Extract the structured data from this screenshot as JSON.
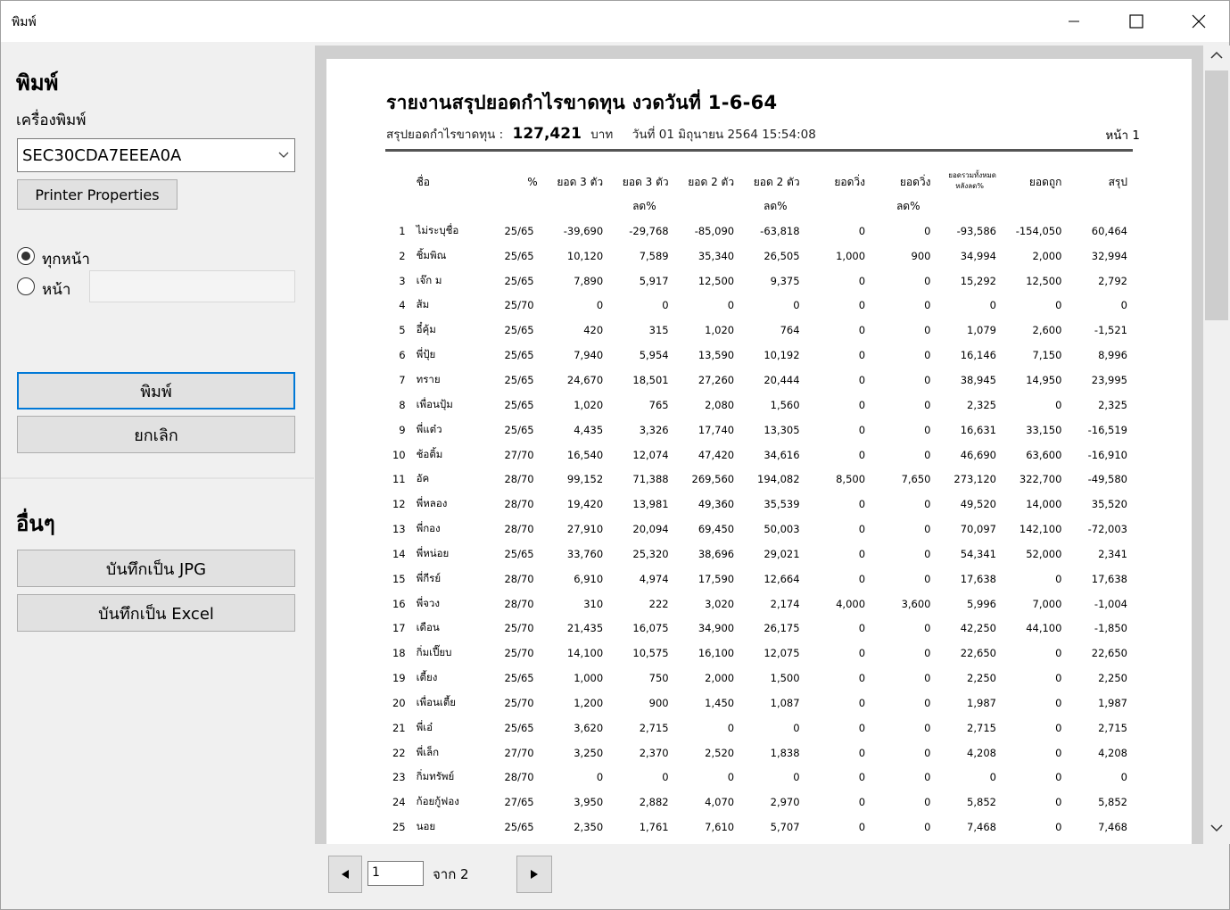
{
  "window": {
    "title": "พิมพ์"
  },
  "left": {
    "print_heading": "พิมพ์",
    "printer_label": "เครื่องพิมพ์",
    "printer_value": "SEC30CDA7EEEA0A",
    "printer_properties": "Printer Properties",
    "radio_all": "ทุกหน้า",
    "radio_page": "หน้า",
    "print_button": "พิมพ์",
    "cancel_button": "ยกเลิก",
    "other_heading": "อื่นๆ",
    "save_jpg": "บันทึกเป็น JPG",
    "save_excel": "บันทึกเป็น Excel"
  },
  "report": {
    "title": "รายงานสรุปยอดกำไรขาดทุน งวดวันที่ 1-6-64",
    "sub_label": "สรุปยอดกำไรขาดทุน :",
    "sub_amount": "127,421",
    "sub_unit": "บาท",
    "sub_date_label": "วันที่",
    "sub_date": "01 มิถุนายน 2564 15:54:08",
    "page_label": "หน้า",
    "page_num": "1",
    "headers": {
      "name": "ชื่อ",
      "pct": "%",
      "c3": "ยอด 3 ตัว",
      "c3d1": "ยอด 3 ตัว",
      "c3d2": "ลด%",
      "c2": "ยอด 2 ตัว",
      "c2d1": "ยอด 2 ตัว",
      "c2d2": "ลด%",
      "run": "ยอดวิ่ง",
      "rund1": "ยอดวิ่ง",
      "rund2": "ลด%",
      "tot1": "ยอดรวมทั้งหมด",
      "tot2": "หลังลด%",
      "hit": "ยอดถูก",
      "sum": "สรุป"
    },
    "rows": [
      [
        "1",
        "ไม่ระบุชื่อ",
        "25/65",
        "-39,690",
        "-29,768",
        "-85,090",
        "-63,818",
        "0",
        "0",
        "-93,586",
        "-154,050",
        "60,464"
      ],
      [
        "2",
        "ชิ้มพิณ",
        "25/65",
        "10,120",
        "7,589",
        "35,340",
        "26,505",
        "1,000",
        "900",
        "34,994",
        "2,000",
        "32,994"
      ],
      [
        "3",
        "เจ๊ก ม",
        "25/65",
        "7,890",
        "5,917",
        "12,500",
        "9,375",
        "0",
        "0",
        "15,292",
        "12,500",
        "2,792"
      ],
      [
        "4",
        "ส้ม",
        "25/70",
        "0",
        "0",
        "0",
        "0",
        "0",
        "0",
        "0",
        "0",
        "0"
      ],
      [
        "5",
        "อี๋คุ้ม",
        "25/65",
        "420",
        "315",
        "1,020",
        "764",
        "0",
        "0",
        "1,079",
        "2,600",
        "-1,521"
      ],
      [
        "6",
        "พี่ปุ้ย",
        "25/65",
        "7,940",
        "5,954",
        "13,590",
        "10,192",
        "0",
        "0",
        "16,146",
        "7,150",
        "8,996"
      ],
      [
        "7",
        "ทราย",
        "25/65",
        "24,670",
        "18,501",
        "27,260",
        "20,444",
        "0",
        "0",
        "38,945",
        "14,950",
        "23,995"
      ],
      [
        "8",
        "เพื่อนปุ้ม",
        "25/65",
        "1,020",
        "765",
        "2,080",
        "1,560",
        "0",
        "0",
        "2,325",
        "0",
        "2,325"
      ],
      [
        "9",
        "พี่แต๋ว",
        "25/65",
        "4,435",
        "3,326",
        "17,740",
        "13,305",
        "0",
        "0",
        "16,631",
        "33,150",
        "-16,519"
      ],
      [
        "10",
        "ช้อติ้ม",
        "27/70",
        "16,540",
        "12,074",
        "47,420",
        "34,616",
        "0",
        "0",
        "46,690",
        "63,600",
        "-16,910"
      ],
      [
        "11",
        "อัค",
        "28/70",
        "99,152",
        "71,388",
        "269,560",
        "194,082",
        "8,500",
        "7,650",
        "273,120",
        "322,700",
        "-49,580"
      ],
      [
        "12",
        "พี่หลอง",
        "28/70",
        "19,420",
        "13,981",
        "49,360",
        "35,539",
        "0",
        "0",
        "49,520",
        "14,000",
        "35,520"
      ],
      [
        "13",
        "พี่กอง",
        "28/70",
        "27,910",
        "20,094",
        "69,450",
        "50,003",
        "0",
        "0",
        "70,097",
        "142,100",
        "-72,003"
      ],
      [
        "14",
        "พี่หน่อย",
        "25/65",
        "33,760",
        "25,320",
        "38,696",
        "29,021",
        "0",
        "0",
        "54,341",
        "52,000",
        "2,341"
      ],
      [
        "15",
        "พี่กีรย์",
        "28/70",
        "6,910",
        "4,974",
        "17,590",
        "12,664",
        "0",
        "0",
        "17,638",
        "0",
        "17,638"
      ],
      [
        "16",
        "พี่จวง",
        "28/70",
        "310",
        "222",
        "3,020",
        "2,174",
        "4,000",
        "3,600",
        "5,996",
        "7,000",
        "-1,004"
      ],
      [
        "17",
        "เดือน",
        "25/70",
        "21,435",
        "16,075",
        "34,900",
        "26,175",
        "0",
        "0",
        "42,250",
        "44,100",
        "-1,850"
      ],
      [
        "18",
        "กิ่มเปี๊ยบ",
        "25/70",
        "14,100",
        "10,575",
        "16,100",
        "12,075",
        "0",
        "0",
        "22,650",
        "0",
        "22,650"
      ],
      [
        "19",
        "เตี้ยง",
        "25/65",
        "1,000",
        "750",
        "2,000",
        "1,500",
        "0",
        "0",
        "2,250",
        "0",
        "2,250"
      ],
      [
        "20",
        "เพื่อนเตี้ย",
        "25/70",
        "1,200",
        "900",
        "1,450",
        "1,087",
        "0",
        "0",
        "1,987",
        "0",
        "1,987"
      ],
      [
        "21",
        "พี่เอ๋",
        "25/65",
        "3,620",
        "2,715",
        "0",
        "0",
        "0",
        "0",
        "2,715",
        "0",
        "2,715"
      ],
      [
        "22",
        "พี่เล็ก",
        "27/70",
        "3,250",
        "2,370",
        "2,520",
        "1,838",
        "0",
        "0",
        "4,208",
        "0",
        "4,208"
      ],
      [
        "23",
        "กิ่มทรัพย์",
        "28/70",
        "0",
        "0",
        "0",
        "0",
        "0",
        "0",
        "0",
        "0",
        "0"
      ],
      [
        "24",
        "ก้อยกู้ฟอง",
        "27/65",
        "3,950",
        "2,882",
        "4,070",
        "2,970",
        "0",
        "0",
        "5,852",
        "0",
        "5,852"
      ],
      [
        "25",
        "นอย",
        "25/65",
        "2,350",
        "1,761",
        "7,610",
        "5,707",
        "0",
        "0",
        "7,468",
        "0",
        "7,468"
      ]
    ]
  },
  "pager": {
    "current": "1",
    "of_label": "จาก 2"
  }
}
